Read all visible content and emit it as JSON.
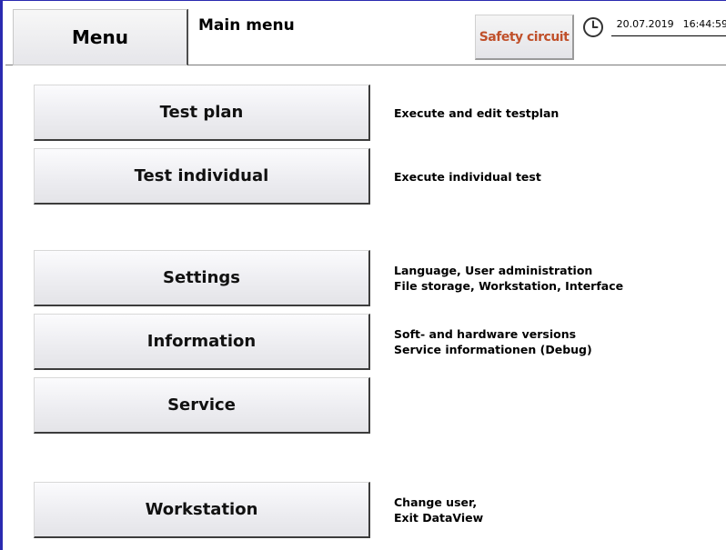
{
  "header": {
    "menu_label": "Menu",
    "title": "Main menu",
    "safety_label": "Safety circuit",
    "date": "20.07.2019",
    "time": "16:44:59"
  },
  "menu": {
    "test_plan": {
      "label": "Test plan",
      "desc": [
        "Execute and edit testplan"
      ]
    },
    "test_individual": {
      "label": "Test individual",
      "desc": [
        "Execute individual test"
      ]
    },
    "settings": {
      "label": "Settings",
      "desc": [
        "Language, User administration",
        "File storage, Workstation, Interface"
      ]
    },
    "information": {
      "label": "Information",
      "desc": [
        "Soft- and hardware versions",
        "Service informationen (Debug)"
      ]
    },
    "service": {
      "label": "Service"
    },
    "workstation": {
      "label": "Workstation",
      "desc": [
        "Change user,",
        "Exit DataView"
      ]
    }
  },
  "colors": {
    "frame": "#2a2ab0",
    "safety_text": "#c0502a"
  },
  "icons": {
    "clock": "clock-icon"
  }
}
